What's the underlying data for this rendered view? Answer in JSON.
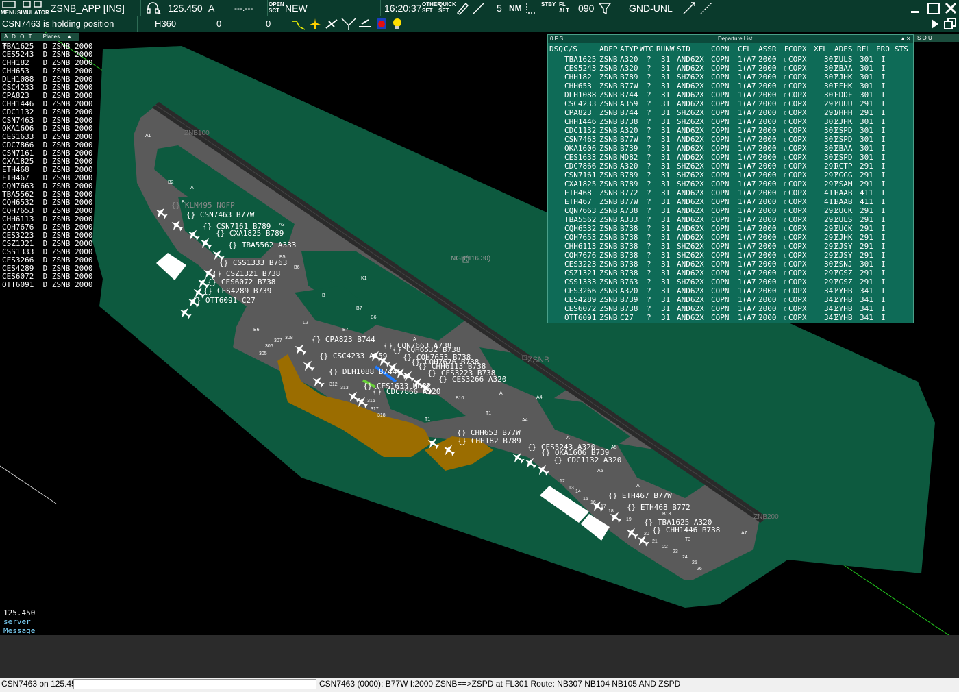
{
  "toolbar": {
    "menu_label": "MENU",
    "simulator_label": "SIMULATOR",
    "position": "ZSNB_APP [INS]",
    "headset_sub": "1",
    "frequency": "125.450",
    "atis_letter": "A",
    "secondary_freq": "---.---",
    "open_sct_label": "OPEN\nSCT",
    "new_label": "NEW",
    "clock": "16:20:37",
    "other_set_label": "OTHER\nSET",
    "quick_set_label": "QUICK\nSET",
    "range_value": "5",
    "nm_label": "NM",
    "stby_label": "STBY",
    "fl_alt_label": "FL\nALT",
    "transition_level": "090",
    "altitude_filter": "GND-UNL"
  },
  "status_line": {
    "message": "CSN7463 is holding position",
    "heading": "H360",
    "value1": "0",
    "value2": "0"
  },
  "plane_list": {
    "header_cols": [
      "A",
      "D",
      "O",
      "T"
    ],
    "header_title": "Planes",
    "rows": [
      "TBA1625  D ZSNB 2000",
      "CES5243  D ZSNB 2000",
      "CHH182   D ZSNB 2000",
      "CHH653   D ZSNB 2000",
      "DLH1088  D ZSNB 2000",
      "CSC4233  D ZSNB 2000",
      "CPA823   D ZSNB 2000",
      "CHH1446  D ZSNB 2000",
      "CDC1132  D ZSNB 2000",
      "CSN7463  D ZSNB 2000",
      "OKA1606  D ZSNB 2000",
      "CES1633  D ZSNB 2000",
      "CDC7866  D ZSNB 2000",
      "CSN7161  D ZSNB 2000",
      "CXA1825  D ZSNB 2000",
      "ETH468   D ZSNB 2000",
      "ETH467   D ZSNB 2000",
      "CQN7663  D ZSNB 2000",
      "TBA5562  D ZSNB 2000",
      "CQH6532  D ZSNB 2000",
      "CQH7653  D ZSNB 2000",
      "CHH6113  D ZSNB 2000",
      "CQH7676  D ZSNB 2000",
      "CES3223  D ZSNB 2000",
      "CSZ1321  D ZSNB 2000",
      "CSS1333  D ZSNB 2000",
      "CES3266  D ZSNB 2000",
      "CES4289  D ZSNB 2000",
      "CES6072  D ZSNB 2000",
      "OTT6091  D ZSNB 2000"
    ]
  },
  "departure_list": {
    "title": "Departure List",
    "flags_left": "0 F S",
    "flags_right": "S O U",
    "columns": [
      "DSQ",
      "C/S",
      "ADEP",
      "ATYP",
      "WTC",
      "RUNW",
      "SID",
      "COPN",
      "CFL",
      "ASSR",
      "E",
      "COPX",
      "XFL",
      "ADES",
      "RFL",
      "FRO",
      "STS"
    ],
    "rows": [
      [
        "TBA1625",
        "ZSNB",
        "A320",
        "?",
        "31",
        "AND62X",
        "COPN",
        "1(A7",
        "2000",
        "COPX",
        "301",
        "ZULS",
        "301",
        "I"
      ],
      [
        "CES5243",
        "ZSNB",
        "A320",
        "?",
        "31",
        "AND62X",
        "COPN",
        "1(A7",
        "2000",
        "COPX",
        "301",
        "ZBAA",
        "301",
        "I"
      ],
      [
        "CHH182",
        "ZSNB",
        "B789",
        "?",
        "31",
        "SHZ62X",
        "COPN",
        "1(A7",
        "2000",
        "COPX",
        "301",
        "ZJHK",
        "301",
        "I"
      ],
      [
        "CHH653",
        "ZSNB",
        "B77W",
        "?",
        "31",
        "AND62X",
        "COPN",
        "1(A7",
        "2000",
        "COPX",
        "301",
        "EFHK",
        "301",
        "I"
      ],
      [
        "DLH1088",
        "ZSNB",
        "B744",
        "?",
        "31",
        "AND62X",
        "COPN",
        "1(A7",
        "2000",
        "COPX",
        "301",
        "EDDF",
        "301",
        "I"
      ],
      [
        "CSC4233",
        "ZSNB",
        "A359",
        "?",
        "31",
        "AND62X",
        "COPN",
        "1(A7",
        "2000",
        "COPX",
        "291",
        "ZUUU",
        "291",
        "I"
      ],
      [
        "CPA823",
        "ZSNB",
        "B744",
        "?",
        "31",
        "SHZ62X",
        "COPN",
        "1(A7",
        "2000",
        "COPX",
        "291",
        "VHHH",
        "291",
        "I"
      ],
      [
        "CHH1446",
        "ZSNB",
        "B738",
        "?",
        "31",
        "SHZ62X",
        "COPN",
        "1(A7",
        "2000",
        "COPX",
        "301",
        "ZJHK",
        "301",
        "I"
      ],
      [
        "CDC1132",
        "ZSNB",
        "A320",
        "?",
        "31",
        "AND62X",
        "COPN",
        "1(A7",
        "2000",
        "COPX",
        "301",
        "ZSPD",
        "301",
        "I"
      ],
      [
        "CSN7463",
        "ZSNB",
        "B77W",
        "?",
        "31",
        "AND62X",
        "COPN",
        "1(A7",
        "2000",
        "COPX",
        "301",
        "ZSPD",
        "301",
        "I"
      ],
      [
        "OKA1606",
        "ZSNB",
        "B739",
        "?",
        "31",
        "AND62X",
        "COPN",
        "1(A7",
        "2000",
        "COPX",
        "301",
        "ZBAA",
        "301",
        "I"
      ],
      [
        "CES1633",
        "ZSNB",
        "MD82",
        "?",
        "31",
        "AND62X",
        "COPN",
        "1(A7",
        "2000",
        "COPX",
        "301",
        "ZSPD",
        "301",
        "I"
      ],
      [
        "CDC7866",
        "ZSNB",
        "A320",
        "?",
        "31",
        "SHZ62X",
        "COPN",
        "1(A7",
        "2000",
        "COPX",
        "291",
        "RCTP",
        "291",
        "I"
      ],
      [
        "CSN7161",
        "ZSNB",
        "B789",
        "?",
        "31",
        "SHZ62X",
        "COPN",
        "1(A7",
        "2000",
        "COPX",
        "291",
        "ZGGG",
        "291",
        "I"
      ],
      [
        "CXA1825",
        "ZSNB",
        "B789",
        "?",
        "31",
        "SHZ62X",
        "COPN",
        "1(A7",
        "2000",
        "COPX",
        "291",
        "ZSAM",
        "291",
        "I"
      ],
      [
        "ETH468",
        "ZSNB",
        "B772",
        "?",
        "31",
        "AND62X",
        "COPN",
        "1(A7",
        "2000",
        "COPX",
        "411",
        "HAAB",
        "411",
        "I"
      ],
      [
        "ETH467",
        "ZSNB",
        "B77W",
        "?",
        "31",
        "AND62X",
        "COPN",
        "1(A7",
        "2000",
        "COPX",
        "411",
        "HAAB",
        "411",
        "I"
      ],
      [
        "CQN7663",
        "ZSNB",
        "A738",
        "?",
        "31",
        "AND62X",
        "COPN",
        "1(A7",
        "2000",
        "COPX",
        "291",
        "ZUCK",
        "291",
        "I"
      ],
      [
        "TBA5562",
        "ZSNB",
        "A333",
        "?",
        "31",
        "AND62X",
        "COPN",
        "1(A7",
        "2000",
        "COPX",
        "291",
        "ZULS",
        "291",
        "I"
      ],
      [
        "CQH6532",
        "ZSNB",
        "B738",
        "?",
        "31",
        "AND62X",
        "COPN",
        "1(A7",
        "2000",
        "COPX",
        "291",
        "ZUCK",
        "291",
        "I"
      ],
      [
        "CQH7653",
        "ZSNB",
        "B738",
        "?",
        "31",
        "AND62X",
        "COPN",
        "1(A7",
        "2000",
        "COPX",
        "291",
        "ZJHK",
        "291",
        "I"
      ],
      [
        "CHH6113",
        "ZSNB",
        "B738",
        "?",
        "31",
        "SHZ62X",
        "COPN",
        "1(A7",
        "2000",
        "COPX",
        "291",
        "ZJSY",
        "291",
        "I"
      ],
      [
        "CQH7676",
        "ZSNB",
        "B738",
        "?",
        "31",
        "SHZ62X",
        "COPN",
        "1(A7",
        "2000",
        "COPX",
        "291",
        "ZJSY",
        "291",
        "I"
      ],
      [
        "CES3223",
        "ZSNB",
        "B738",
        "?",
        "31",
        "AND62X",
        "COPN",
        "1(A7",
        "2000",
        "COPX",
        "301",
        "ZSNJ",
        "301",
        "I"
      ],
      [
        "CSZ1321",
        "ZSNB",
        "B738",
        "?",
        "31",
        "AND62X",
        "COPN",
        "1(A7",
        "2000",
        "COPX",
        "291",
        "ZGSZ",
        "291",
        "I"
      ],
      [
        "CSS1333",
        "ZSNB",
        "B763",
        "?",
        "31",
        "SHZ62X",
        "COPN",
        "1(A7",
        "2000",
        "COPX",
        "291",
        "ZGSZ",
        "291",
        "I"
      ],
      [
        "CES3266",
        "ZSNB",
        "A320",
        "?",
        "31",
        "AND62X",
        "COPN",
        "1(A7",
        "2000",
        "COPX",
        "341",
        "ZYHB",
        "341",
        "I"
      ],
      [
        "CES4289",
        "ZSNB",
        "B739",
        "?",
        "31",
        "AND62X",
        "COPN",
        "1(A7",
        "2000",
        "COPX",
        "341",
        "ZYHB",
        "341",
        "I"
      ],
      [
        "CES6072",
        "ZSNB",
        "B738",
        "?",
        "31",
        "AND62X",
        "COPN",
        "1(A7",
        "2000",
        "COPX",
        "341",
        "ZYHB",
        "341",
        "I"
      ],
      [
        "OTT6091",
        "ZSNB",
        "C27",
        "?",
        "31",
        "AND62X",
        "COPN",
        "1(A7",
        "2000",
        "COPX",
        "341",
        "ZYHB",
        "341",
        "I"
      ]
    ]
  },
  "map": {
    "airport_label": "ZSNB",
    "vor_label": "NGB(116.30)",
    "rwy_north": "ZNB100",
    "rwy_south": "ZNB200",
    "taxiway_labels": [
      "A1",
      "B2",
      "A",
      "B",
      "A3",
      "B5",
      "B6",
      "K1",
      "B",
      "B7",
      "B6",
      "L2",
      "B7",
      "B6",
      "307",
      "308",
      "306",
      "305",
      "312",
      "313",
      "316",
      "317",
      "318",
      "B10",
      "A",
      "A4",
      "T1",
      "T1",
      "A4",
      "A",
      "A5",
      "A",
      "A5",
      "B13",
      "A7",
      "T3",
      "A",
      "12",
      "13",
      "14",
      "15",
      "16",
      "17",
      "18",
      "19",
      "20",
      "21",
      "22",
      "23",
      "24",
      "25",
      "26"
    ],
    "aircraft_tags": [
      "{} KLM495 NOFP",
      "{} CSN7463 B77W",
      "{} CSN7161 B789",
      "{} CXA1825 B789",
      "{} TBA5562 A333",
      "{} CSS1333 B763",
      "{} CSZ1321 B738",
      "{} CES6072 B738",
      "{} CES4289 B739",
      "{} OTT6091 C27",
      "{} CPA823 B744",
      "{} CQN7663 A738",
      "{} CQH6532 B738",
      "{} CSC4233 A359",
      "{} CQH7653 B738",
      "{} CQH7676 B738",
      "{} CHH6113 B738",
      "{} DLH1088 B744",
      "{} CES3223 B738",
      "{} CES3266 A320",
      "{} CES1633 MD82",
      "{} CDC7866 A320",
      "{} CHH653 B77W",
      "{} CHH182 B789",
      "{} CES5243 A320",
      "{} OKA1606 B739",
      "{} CDC1132 A320",
      "{} ETH467 B77W",
      "{} ETH468 B772",
      "{} TBA1625 A320",
      "{} CHH1446 B738"
    ]
  },
  "messages": {
    "freq": "125.450",
    "server": "server",
    "message": "Message"
  },
  "statusbar": {
    "frequency_status": "CSN7463 on 125.450",
    "input_value": "",
    "flight_info": "CSN7463 (0000): B77W I:2000 ZSNB==>ZSPD at FL301 Route: NB307 NB104 NB105 AND ZSPD"
  },
  "colors": {
    "toolbar_bg": "#0a3a2c",
    "grass": "#0d5a3f",
    "pavement": "#5a5a5a",
    "runway": "#2a2a2a",
    "apron_brown": "#9b6d00",
    "deplist_bg": "#0e6b57"
  }
}
